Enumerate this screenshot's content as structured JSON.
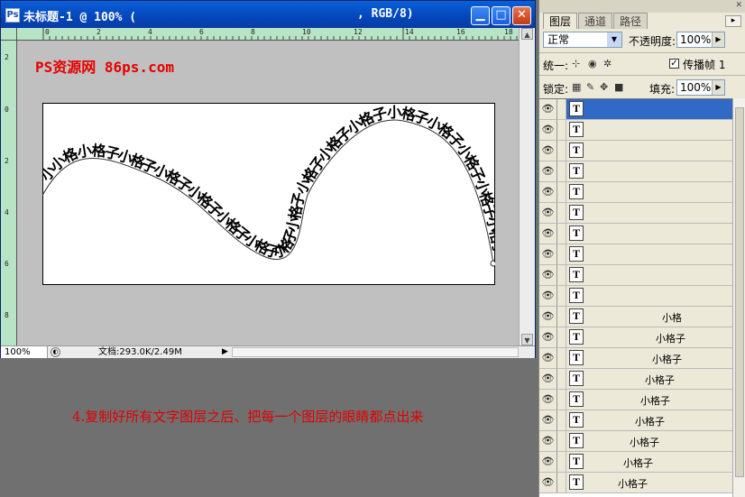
{
  "document": {
    "title": "未标题-1 @ 100% (",
    "mode": ", RGB/8)",
    "watermark": "PS资源网 86ps.com",
    "ruler_top_ticks": [
      "0",
      "2",
      "4",
      "6",
      "8",
      "10",
      "12",
      "14",
      "16",
      "18"
    ],
    "ruler_left_ticks": [
      "2",
      "0",
      "2",
      "4",
      "6",
      "8"
    ],
    "zoom": "100%",
    "doc_info": "文档:293.0K/2.49M",
    "path_text": "小小格小格子小格子小格子小格子小格子小格子小格子小格子小格子小格子小格子小格子小格子小格子小格子小格子小格子小格子小格子"
  },
  "instruction": "4.复制好所有文字图层之后、把每一个图层的眼睛都点出来",
  "panel": {
    "tabs": [
      "图层",
      "通道",
      "路径"
    ],
    "blend_mode": "正常",
    "opacity_label": "不透明度:",
    "opacity_value": "100%",
    "unify_label": "统一:",
    "propagate_label": "传播帧 1",
    "lock_label": "锁定:",
    "fill_label": "填充:",
    "fill_value": "100%",
    "layers": [
      "",
      "",
      "",
      "",
      "",
      "",
      "",
      "",
      "",
      "",
      "小格",
      "小格子",
      "小格子",
      "小格子",
      "小格子",
      "小格子",
      "小格子",
      "小格子",
      "小格子"
    ]
  }
}
